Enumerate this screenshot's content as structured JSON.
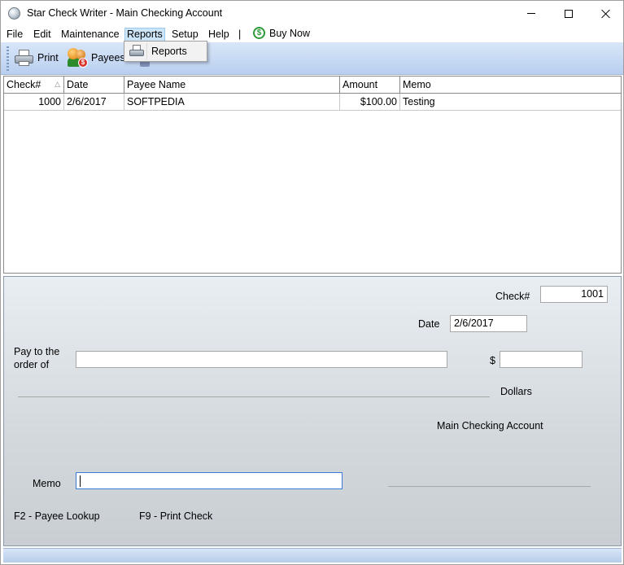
{
  "window": {
    "title": "Star Check Writer - Main Checking Account"
  },
  "menu": {
    "file": "File",
    "edit": "Edit",
    "maintenance": "Maintenance",
    "reports": "Reports",
    "setup": "Setup",
    "help": "Help",
    "separator": "|",
    "buy_now": "Buy Now"
  },
  "toolbar": {
    "print": "Print",
    "payees": "Payees"
  },
  "reports_menu": {
    "item": "Reports"
  },
  "grid": {
    "columns": [
      "Check#",
      "Date",
      "Payee Name",
      "Amount",
      "Memo"
    ],
    "rows": [
      {
        "check": "1000",
        "date": "2/6/2017",
        "payee": "SOFTPEDIA",
        "amount": "$100.00",
        "memo": "Testing"
      }
    ]
  },
  "check_form": {
    "check_label": "Check#",
    "check_value": "1001",
    "date_label": "Date",
    "date_value": "2/6/2017",
    "pay_label_line1": "Pay to the",
    "pay_label_line2": "order of",
    "payee_value": "",
    "dollar_sign": "$",
    "amount_value": "",
    "dollars_label": "Dollars",
    "account_name": "Main Checking Account",
    "memo_label": "Memo",
    "memo_value": ""
  },
  "hints": {
    "payee_lookup": "F2 - Payee Lookup",
    "print_check": "F9 - Print Check"
  }
}
